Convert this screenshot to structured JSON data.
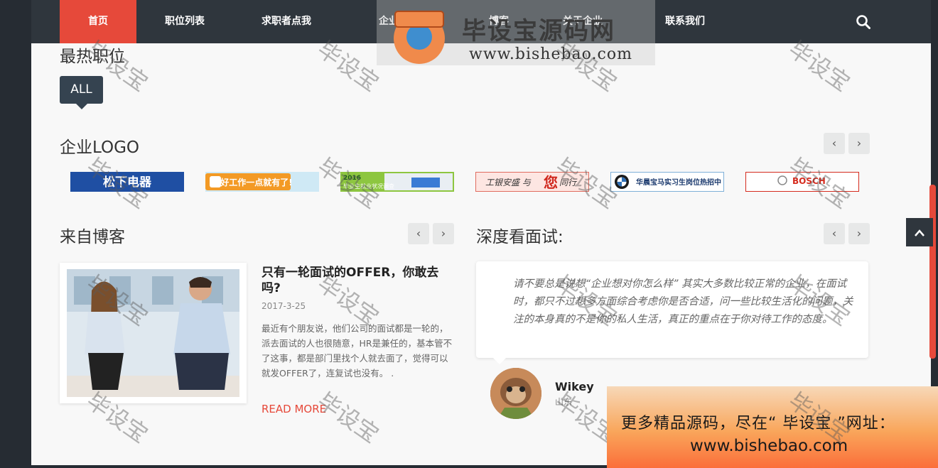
{
  "nav": {
    "items": [
      "首页",
      "职位列表",
      "求职者点我",
      "企业用户点我",
      "博客",
      "关于企业",
      "联系我们"
    ]
  },
  "sections": {
    "hot_jobs_title": "最热职位",
    "filter_all": "ALL",
    "logos_title": "企业LOGO",
    "blog_title": "来自博客",
    "interview_title": "深度看面试:"
  },
  "logos": [
    {
      "text": "松下电器",
      "bg": "#1f4fa3",
      "fg": "#ffffff"
    },
    {
      "text": "好工作一点就有了!",
      "bg": "#f39a25",
      "fg": "#ffffff"
    },
    {
      "text": "毕业生就业状况调查",
      "bg": "#8dc640",
      "fg": "#ffffff"
    },
    {
      "text": "工银安盛 与您同行",
      "bg": "#fde6e2",
      "fg": "#c0392b"
    },
    {
      "text": "华晨宝马实习生岗位热招中",
      "bg": "#ffffff",
      "fg": "#1b3a6e"
    },
    {
      "text": "BOSCH",
      "bg": "#ffffff",
      "fg": "#d52b1e"
    }
  ],
  "blog": {
    "title": "只有一轮面试的OFFER，你敢去吗?",
    "date": "2017-3-25",
    "excerpt": "最近有个朋友说，他们公司的面试都是一轮的，派去面试的人也很随意，HR是兼任的，基本管不了这事，都是部门里找个人就去面了，觉得可以就发OFFER了，连复试也没有。 .",
    "read_more": "READ MORE"
  },
  "testimonial": {
    "quote": "请不要总是说想“企业想对你怎么样” 其实大多数比较正常的企业，在面试时，都只不过想多方面综合考虑你是否合适，问一些比较生活化的问题，关注的本身真的不是你的私人生活，真正的重点在于你对待工作的态度。",
    "author": "Wikey",
    "location": "山东"
  },
  "watermark": {
    "site_name": "毕设宝源码网",
    "site_url": "www.bishebao.com",
    "stamp": "毕设宝",
    "promo_line1": "更多精品源码，尽在“ 毕设宝 ”网址：",
    "promo_line2": "www.bishebao.com"
  },
  "colors": {
    "accent": "#e6493a",
    "nav_bg": "#2f363d",
    "button_dark": "#354350"
  }
}
